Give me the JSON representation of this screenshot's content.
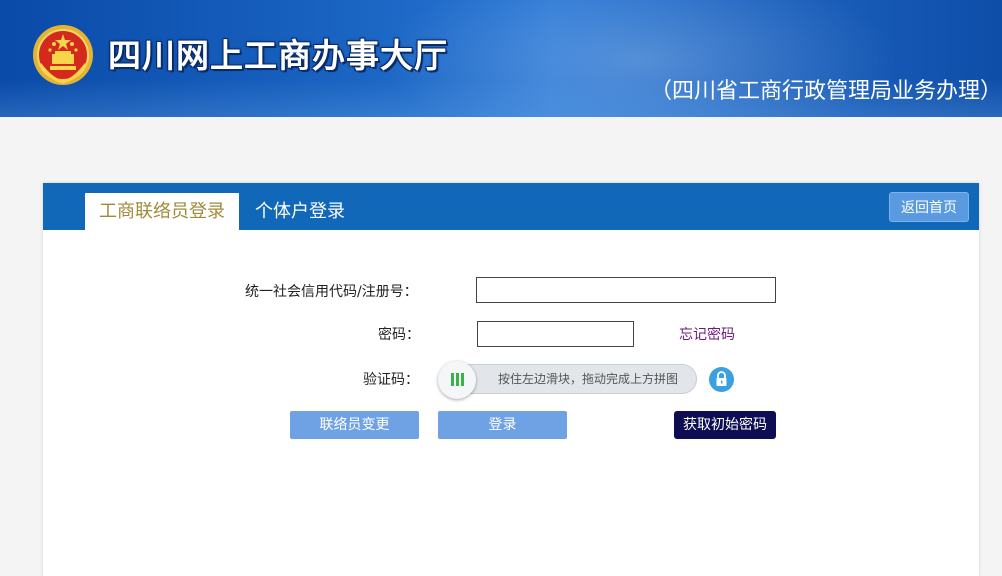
{
  "header": {
    "site_title": "四川网上工商办事大厅",
    "subtitle": "（四川省工商行政管理局业务办理）"
  },
  "tabs": [
    {
      "label": "工商联络员登录",
      "active": true
    },
    {
      "label": "个体户登录",
      "active": false
    }
  ],
  "home_button": "返回首页",
  "form": {
    "credit_code_label": "统一社会信用代码/注册号：",
    "credit_code_value": "",
    "password_label": "密码：",
    "password_value": "",
    "forgot_password": "忘记密码",
    "captcha_label": "验证码：",
    "slider_hint": "按住左边滑块，拖动完成上方拼图"
  },
  "buttons": {
    "change_contact": "联络员变更",
    "login": "登录",
    "get_initial_password": "获取初始密码"
  },
  "colors": {
    "header_blue": "#1168b8",
    "active_tab_text": "#a08a3a",
    "forgot_link": "#6b1a7a",
    "light_button": "#6fa2e4",
    "dark_button": "#0e0c52"
  }
}
